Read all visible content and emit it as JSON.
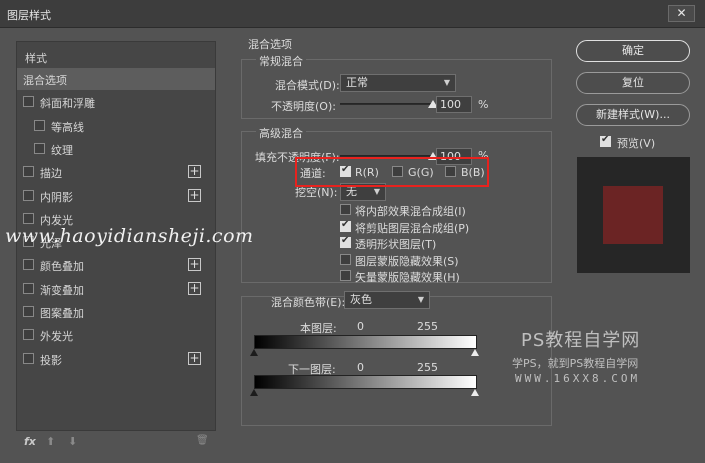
{
  "window": {
    "title": "图层样式",
    "close_glyph": "✕"
  },
  "style_list": {
    "header": "样式",
    "items": [
      {
        "label": "混合选项",
        "checkbox": false,
        "checked": false,
        "plus": false,
        "indent": 0,
        "selected": true
      },
      {
        "label": "斜面和浮雕",
        "checkbox": true,
        "checked": false,
        "plus": false,
        "indent": 0,
        "selected": false
      },
      {
        "label": "等高线",
        "checkbox": true,
        "checked": false,
        "plus": false,
        "indent": 1,
        "selected": false
      },
      {
        "label": "纹理",
        "checkbox": true,
        "checked": false,
        "plus": false,
        "indent": 1,
        "selected": false
      },
      {
        "label": "描边",
        "checkbox": true,
        "checked": false,
        "plus": true,
        "indent": 0,
        "selected": false
      },
      {
        "label": "内阴影",
        "checkbox": true,
        "checked": false,
        "plus": true,
        "indent": 0,
        "selected": false
      },
      {
        "label": "内发光",
        "checkbox": true,
        "checked": false,
        "plus": false,
        "indent": 0,
        "selected": false
      },
      {
        "label": "光泽",
        "checkbox": true,
        "checked": false,
        "plus": false,
        "indent": 0,
        "selected": false
      },
      {
        "label": "颜色叠加",
        "checkbox": true,
        "checked": false,
        "plus": true,
        "indent": 0,
        "selected": false
      },
      {
        "label": "渐变叠加",
        "checkbox": true,
        "checked": false,
        "plus": true,
        "indent": 0,
        "selected": false
      },
      {
        "label": "图案叠加",
        "checkbox": true,
        "checked": false,
        "plus": false,
        "indent": 0,
        "selected": false
      },
      {
        "label": "外发光",
        "checkbox": true,
        "checked": false,
        "plus": false,
        "indent": 0,
        "selected": false
      },
      {
        "label": "投影",
        "checkbox": true,
        "checked": false,
        "plus": true,
        "indent": 0,
        "selected": false
      }
    ],
    "footer": {
      "fx": "fx",
      "up": "⬆",
      "down": "⬇",
      "trash": "🗑"
    }
  },
  "blend_options": {
    "title": "混合选项",
    "general": {
      "title": "常规混合",
      "mode_label": "混合模式(D):",
      "mode_value": "正常",
      "opacity_label": "不透明度(O):",
      "opacity_value": "100",
      "opacity_unit": "%",
      "opacity_fraction": 1.0
    },
    "advanced": {
      "title": "高级混合",
      "fill_label": "填充不透明度(F):",
      "fill_value": "100",
      "fill_unit": "%",
      "fill_fraction": 1.0,
      "channels_label": "通道:",
      "channel_r": "R(R)",
      "channel_g": "G(G)",
      "channel_b": "B(B)",
      "channel_r_checked": true,
      "channel_g_checked": false,
      "channel_b_checked": false,
      "knockout_label": "挖空(N):",
      "knockout_value": "无",
      "options": [
        {
          "label": "将内部效果混合成组(I)",
          "checked": false
        },
        {
          "label": "将剪贴图层混合成组(P)",
          "checked": true
        },
        {
          "label": "透明形状图层(T)",
          "checked": true
        },
        {
          "label": "图层蒙版隐藏效果(S)",
          "checked": false
        },
        {
          "label": "矢量蒙版隐藏效果(H)",
          "checked": false
        }
      ]
    },
    "blend_if": {
      "label": "混合颜色带(E):",
      "value": "灰色",
      "this_layer_label": "本图层:",
      "this_layer_min": "0",
      "this_layer_max": "255",
      "under_layer_label": "下一图层:",
      "under_layer_min": "0",
      "under_layer_max": "255"
    }
  },
  "buttons": {
    "ok": "确定",
    "reset": "复位",
    "new_style": "新建样式(W)...",
    "preview_label": "预览(V)",
    "preview_checked": true
  },
  "colors": {
    "highlight": "#e8221e",
    "preview_swatch": "#6b2424"
  },
  "watermarks": {
    "left_url": "www.haoyidiansheji.com",
    "logo": "PS教程自学网",
    "sub": "学PS，就到PS教程自学网",
    "url": "WWW.16XX8.COM"
  }
}
